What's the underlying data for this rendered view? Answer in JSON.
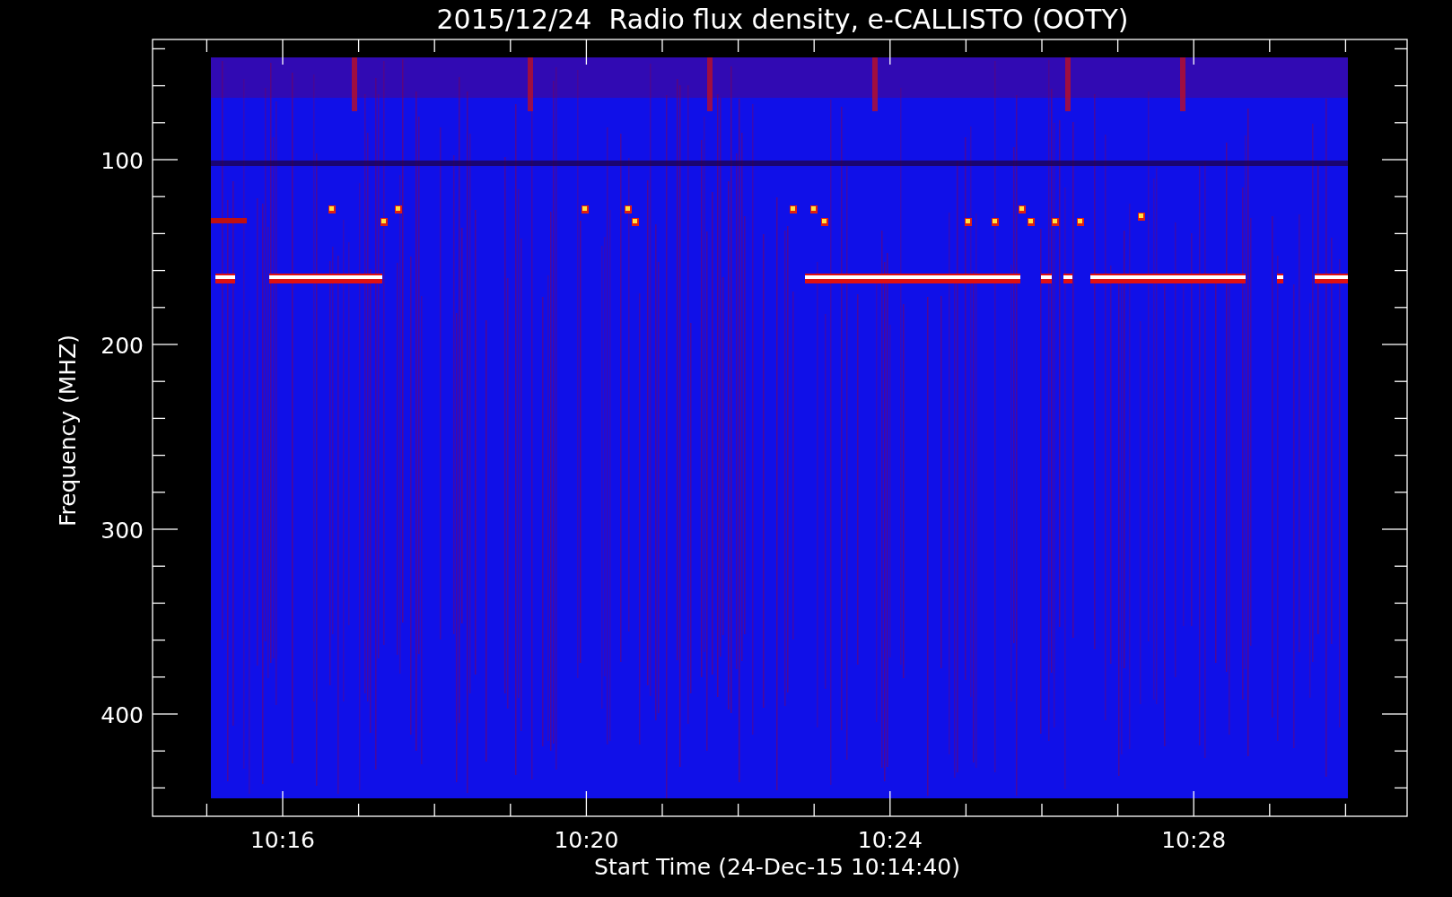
{
  "title": "2015/12/24  Radio flux density, e-CALLISTO (OOTY)",
  "y_axis": {
    "label": "Frequency (MHZ)",
    "ticks": [
      "100",
      "200",
      "300",
      "400"
    ]
  },
  "x_axis": {
    "label": "Start Time (24-Dec-15 10:14:40)",
    "ticks": [
      "10:16",
      "10:20",
      "10:24",
      "10:28"
    ]
  }
}
